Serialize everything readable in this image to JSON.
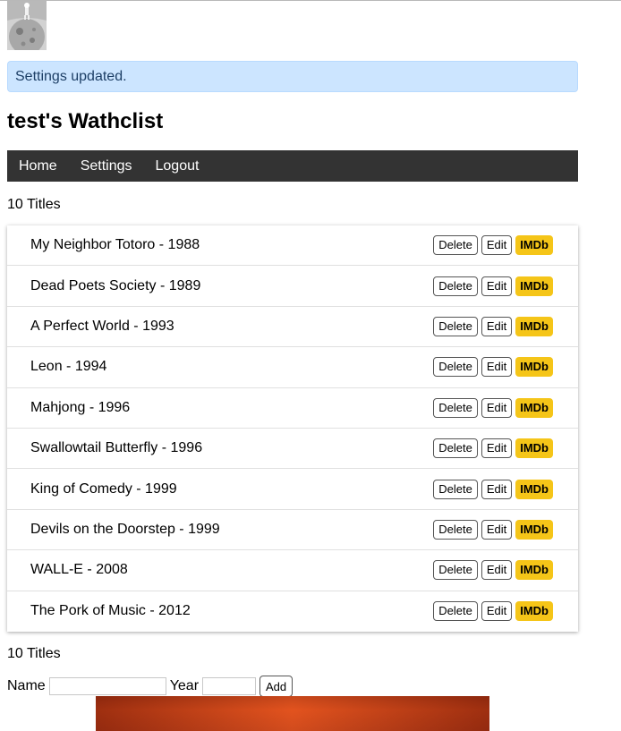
{
  "alert": {
    "message": "Settings updated."
  },
  "header": {
    "title": "test's Wathclist"
  },
  "nav": {
    "items": [
      "Home",
      "Settings",
      "Logout"
    ]
  },
  "summary": {
    "count_label": "10 Titles"
  },
  "movies": [
    {
      "title": "My Neighbor Totoro - 1988"
    },
    {
      "title": "Dead Poets Society - 1989"
    },
    {
      "title": "A Perfect World - 1993"
    },
    {
      "title": "Leon - 1994"
    },
    {
      "title": "Mahjong - 1996"
    },
    {
      "title": "Swallowtail Butterfly - 1996"
    },
    {
      "title": "King of Comedy - 1999"
    },
    {
      "title": "Devils on the Doorstep - 1999"
    },
    {
      "title": "WALL-E - 2008"
    },
    {
      "title": "The Pork of Music - 2012"
    }
  ],
  "actions": {
    "delete": "Delete",
    "edit": "Edit",
    "imdb": "IMDb"
  },
  "form": {
    "name_label": "Name",
    "name_value": "",
    "year_label": "Year",
    "year_value": "",
    "add_label": "Add"
  },
  "colors": {
    "navbar": "#333333",
    "alert_bg": "#cce5ff",
    "imdb": "#f5c518"
  },
  "icons": {
    "avatar": "astronaut-on-moon-avatar"
  }
}
